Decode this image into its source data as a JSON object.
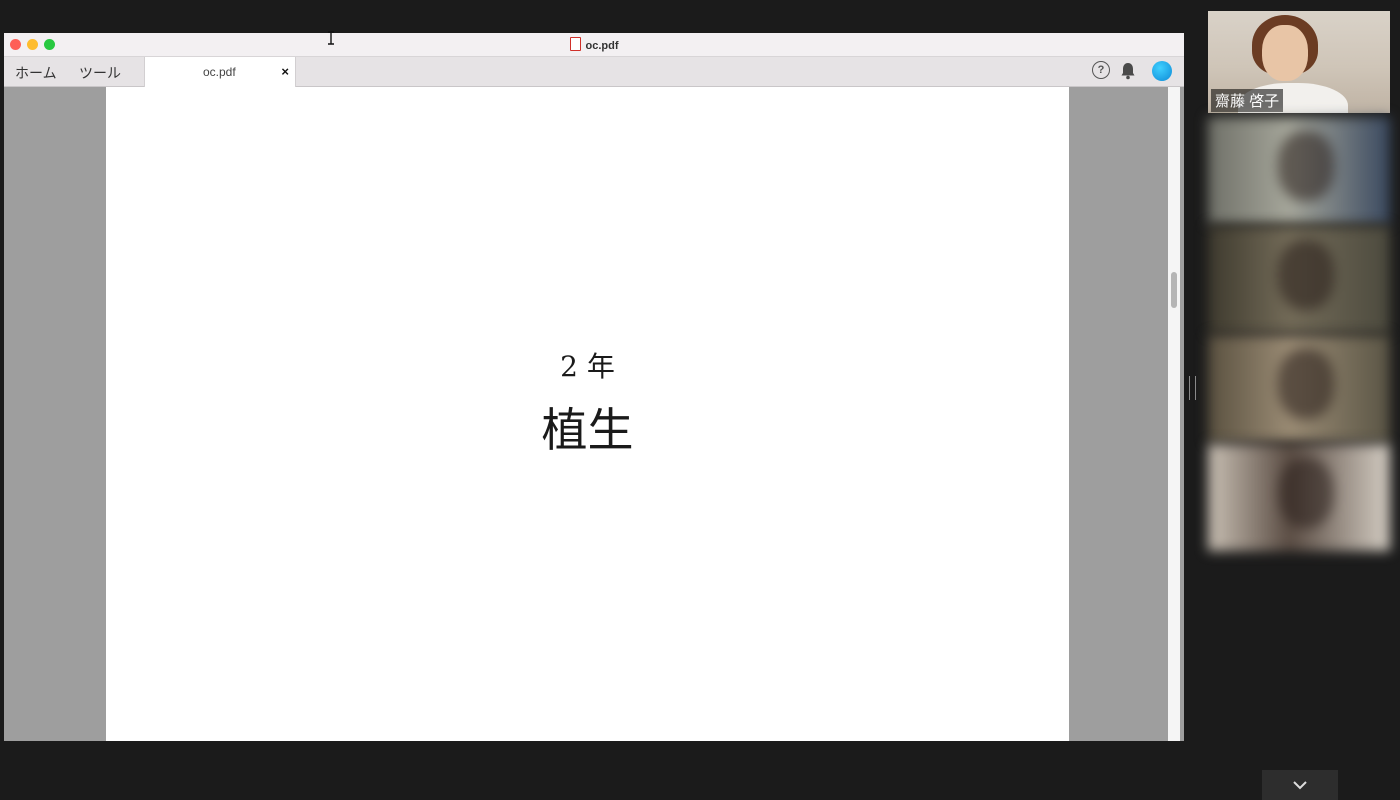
{
  "window": {
    "title": "oc.pdf",
    "nav": {
      "home": "ホーム",
      "tools": "ツール"
    },
    "tab": {
      "label": "oc.pdf",
      "close": "×"
    },
    "help_glyph": "?",
    "icons": [
      "help-icon",
      "bell-icon",
      "account-avatar-icon"
    ]
  },
  "document": {
    "subtitle": "2 年",
    "title": "植生"
  },
  "call": {
    "speaker_name": "齋藤 啓子",
    "participants_count_visible": 4,
    "blurred_labels": [
      "",
      "",
      "",
      ""
    ],
    "expand_glyph": "⌄"
  },
  "colors": {
    "close": "#fe5f57",
    "minimize": "#febc2e",
    "maximize": "#28c840",
    "avatar": "#0e8ad6"
  }
}
